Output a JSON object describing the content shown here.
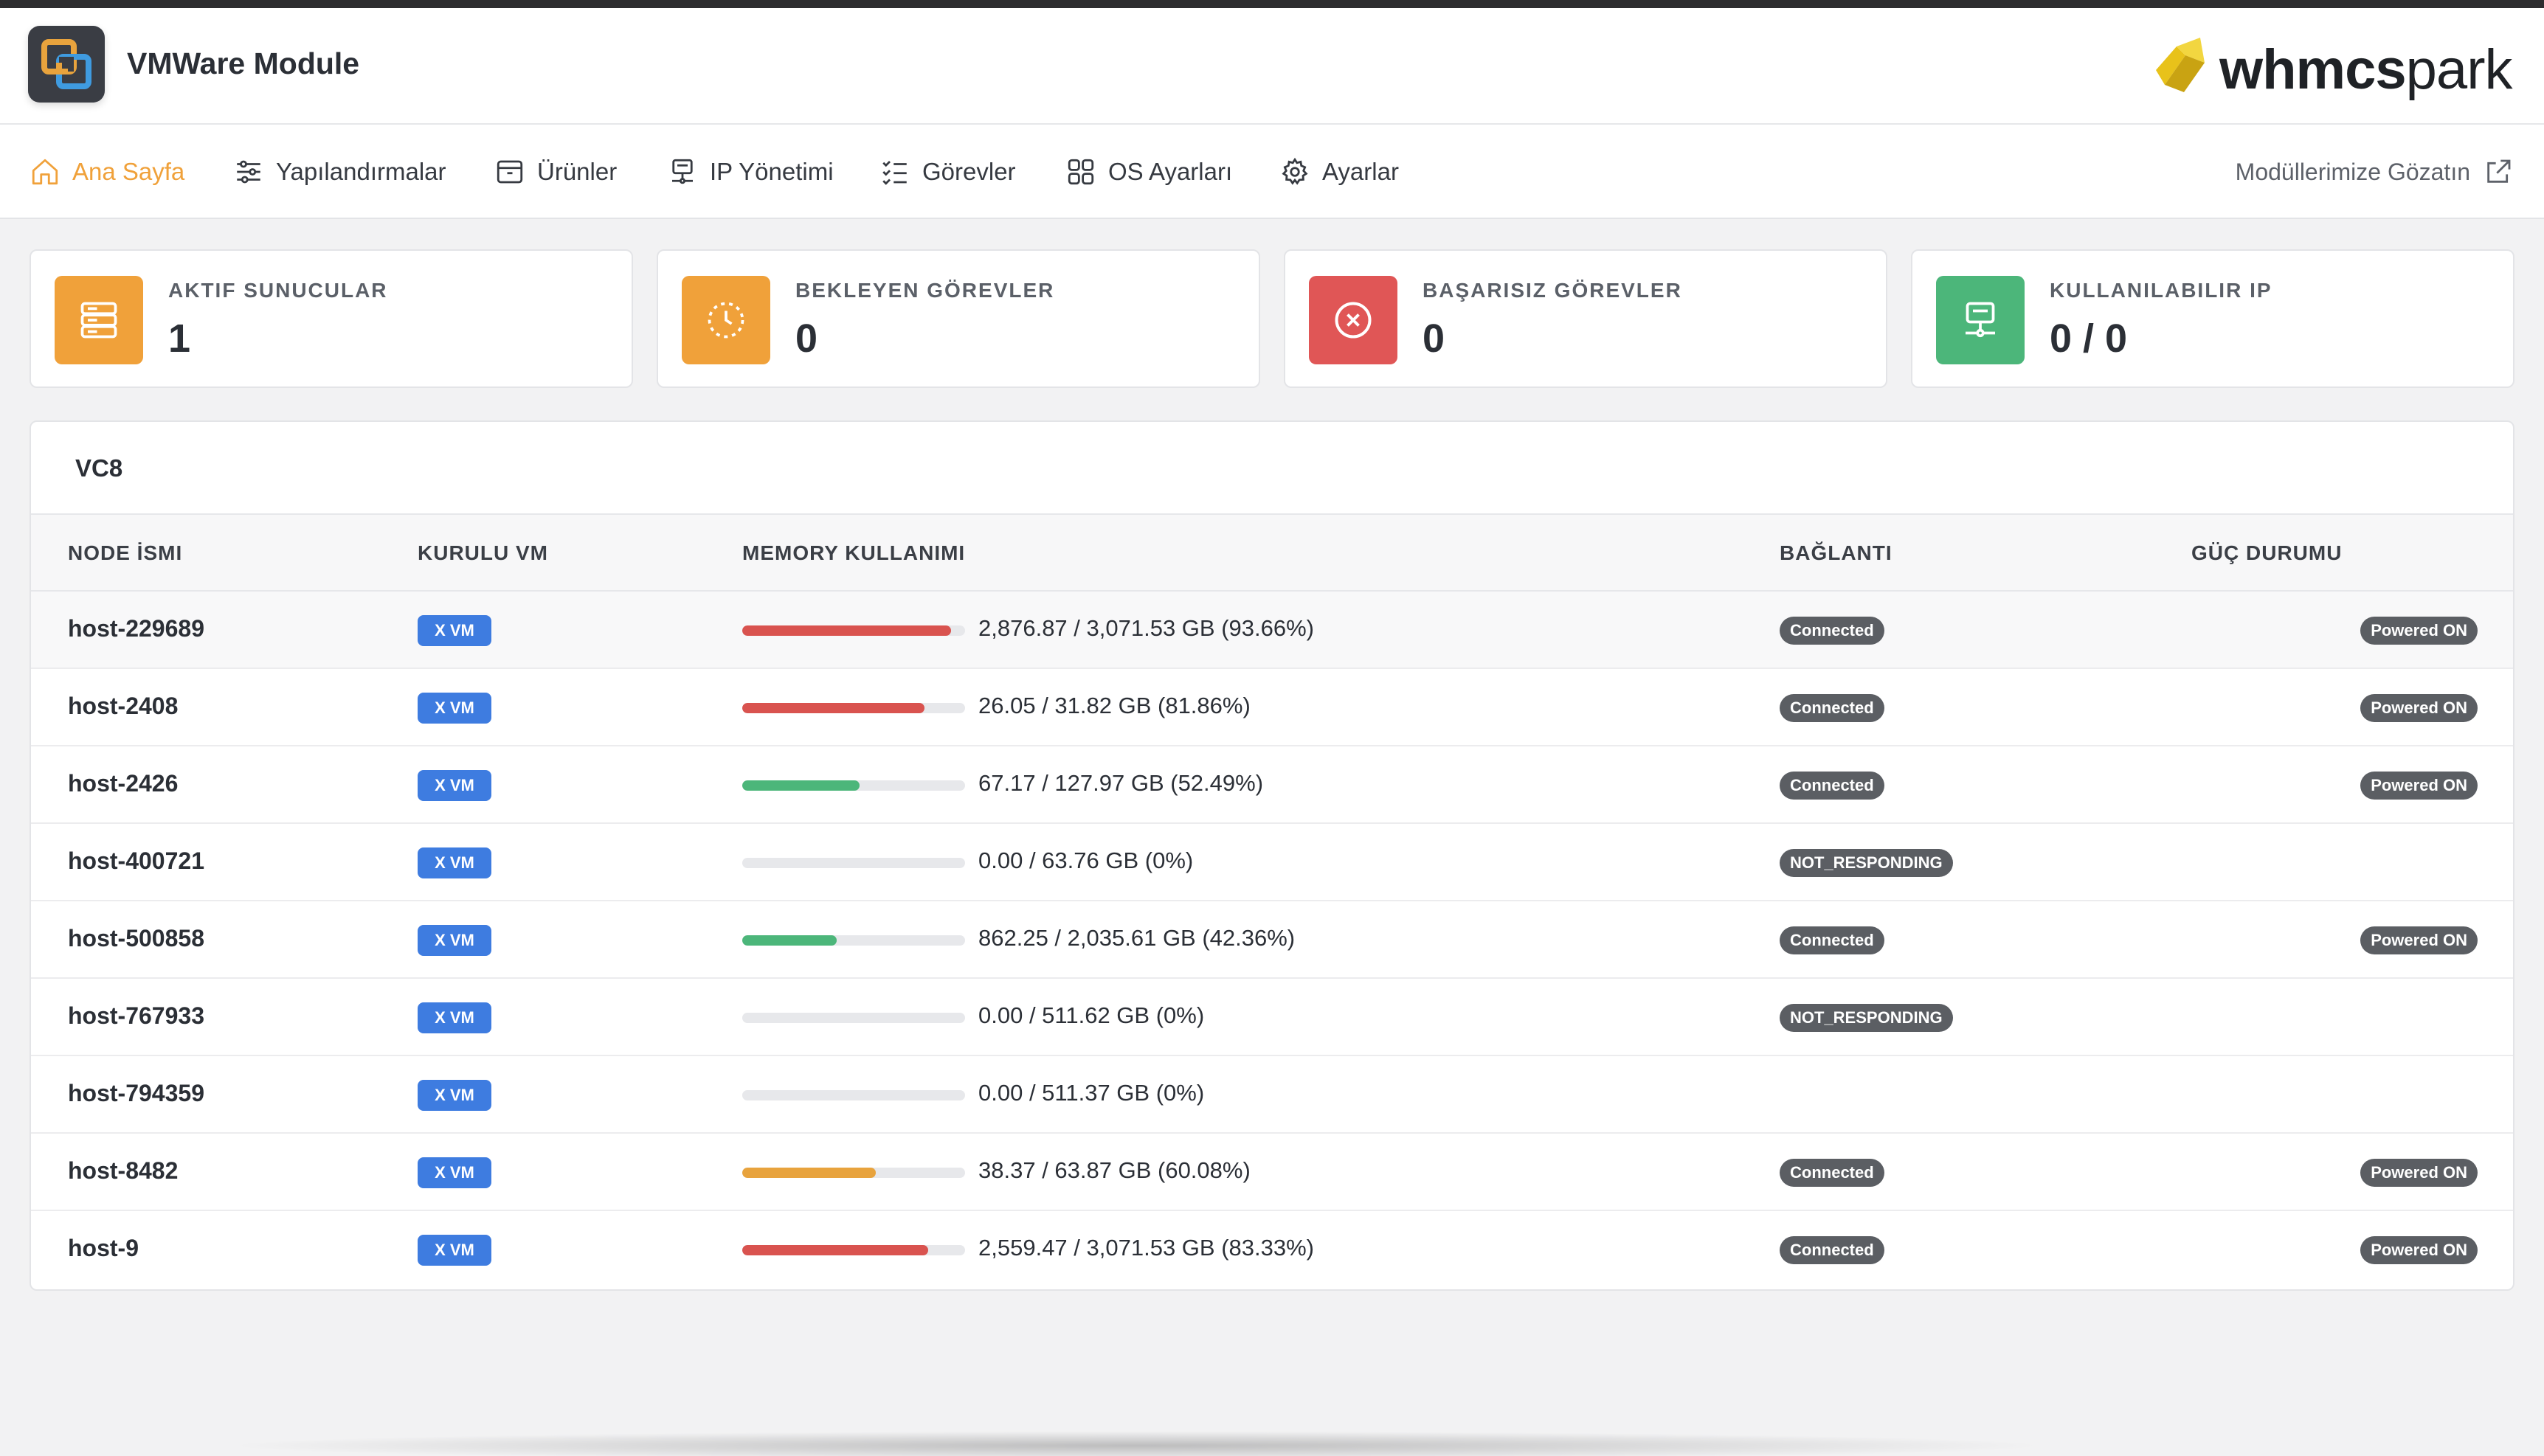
{
  "app": {
    "title": "VMWare Module",
    "brand_bold": "whmcs",
    "brand_light": "park"
  },
  "nav": {
    "items": [
      {
        "label": "Ana Sayfa",
        "icon": "home-icon",
        "active": true
      },
      {
        "label": "Yapılandırmalar",
        "icon": "sliders-icon"
      },
      {
        "label": "Ürünler",
        "icon": "archive-icon"
      },
      {
        "label": "IP Yönetimi",
        "icon": "network-icon"
      },
      {
        "label": "Görevler",
        "icon": "tasks-icon"
      },
      {
        "label": "OS Ayarları",
        "icon": "grid-icon"
      },
      {
        "label": "Ayarlar",
        "icon": "gear-icon"
      }
    ],
    "external_link": "Modüllerimize Gözatın"
  },
  "stats": [
    {
      "label": "AKTIF SUNUCULAR",
      "value": "1",
      "color": "#f0a13a",
      "icon": "server-icon"
    },
    {
      "label": "BEKLEYEN GÖREVLER",
      "value": "0",
      "color": "#f0a13a",
      "icon": "clock-icon"
    },
    {
      "label": "BAŞARISIZ GÖREVLER",
      "value": "0",
      "color": "#e05656",
      "icon": "close-circle-icon"
    },
    {
      "label": "KULLANILABILIR IP",
      "value": "0 / 0",
      "color": "#4cb67a",
      "icon": "network-icon"
    }
  ],
  "panel": {
    "title": "VC8",
    "columns": [
      "NODE İSMI",
      "KURULU VM",
      "MEMORY KULLANIMI",
      "BAĞLANTI",
      "GÜÇ DURUMU"
    ],
    "rows": [
      {
        "name": "host-229689",
        "vm": "X VM",
        "mem": "2,876.87 / 3,071.53 GB (93.66%)",
        "pct": 93.66,
        "bar_color": "#d9534f",
        "conn": "Connected",
        "power": "Powered ON"
      },
      {
        "name": "host-2408",
        "vm": "X VM",
        "mem": "26.05 / 31.82 GB (81.86%)",
        "pct": 81.86,
        "bar_color": "#d9534f",
        "conn": "Connected",
        "power": "Powered ON"
      },
      {
        "name": "host-2426",
        "vm": "X VM",
        "mem": "67.17 / 127.97 GB (52.49%)",
        "pct": 52.49,
        "bar_color": "#4cb67a",
        "conn": "Connected",
        "power": "Powered ON"
      },
      {
        "name": "host-400721",
        "vm": "X VM",
        "mem": "0.00 / 63.76 GB (0%)",
        "pct": 0,
        "bar_color": "#4cb67a",
        "conn": "NOT_RESPONDING",
        "power": ""
      },
      {
        "name": "host-500858",
        "vm": "X VM",
        "mem": "862.25 / 2,035.61 GB (42.36%)",
        "pct": 42.36,
        "bar_color": "#4cb67a",
        "conn": "Connected",
        "power": "Powered ON"
      },
      {
        "name": "host-767933",
        "vm": "X VM",
        "mem": "0.00 / 511.62 GB (0%)",
        "pct": 0,
        "bar_color": "#4cb67a",
        "conn": "NOT_RESPONDING",
        "power": ""
      },
      {
        "name": "host-794359",
        "vm": "X VM",
        "mem": "0.00 / 511.37 GB (0%)",
        "pct": 0,
        "bar_color": "#4cb67a",
        "conn": "",
        "power": ""
      },
      {
        "name": "host-8482",
        "vm": "X VM",
        "mem": "38.37 / 63.87 GB (60.08%)",
        "pct": 60.08,
        "bar_color": "#e8a33d",
        "conn": "Connected",
        "power": "Powered ON"
      },
      {
        "name": "host-9",
        "vm": "X VM",
        "mem": "2,559.47 / 3,071.53 GB (83.33%)",
        "pct": 83.33,
        "bar_color": "#d9534f",
        "conn": "Connected",
        "power": "Powered ON"
      }
    ]
  },
  "colors": {
    "accent": "#f0a13a",
    "badge_blue": "#3e7ce0",
    "pill_gray": "#5b5e63"
  }
}
